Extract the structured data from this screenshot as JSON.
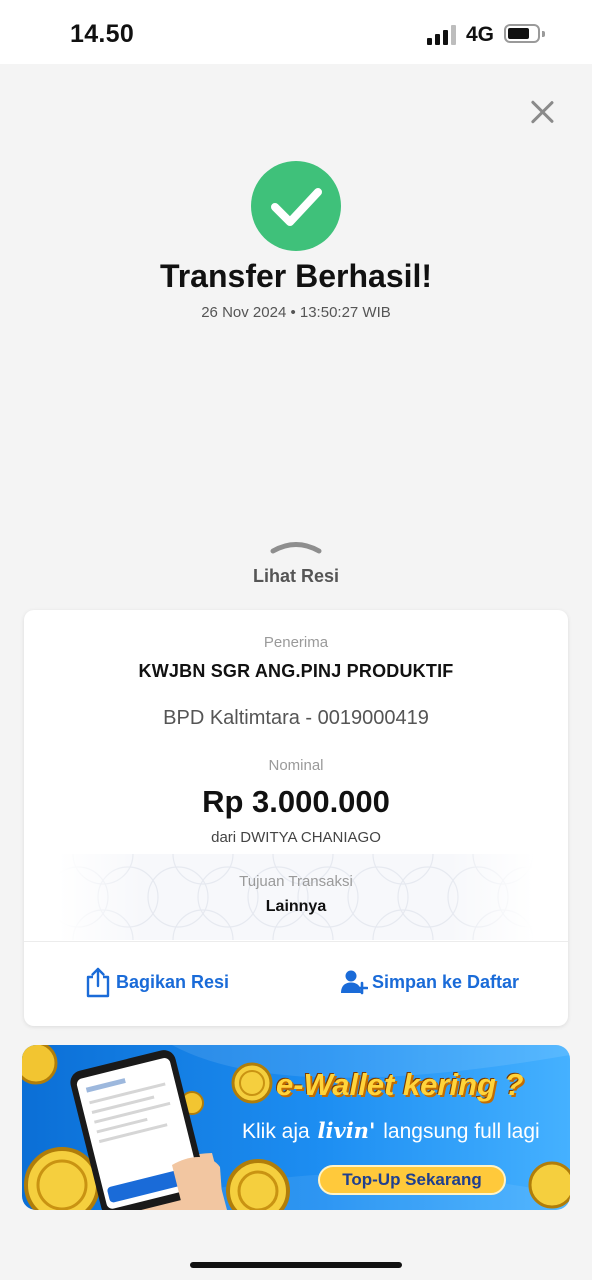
{
  "status_bar": {
    "time": "14.50",
    "network": "4G",
    "signal_bars": 3,
    "signal_bars_total": 4,
    "battery_level": 0.7,
    "icons": [
      "signal-icon",
      "battery-icon"
    ]
  },
  "header": {
    "close_icon": "close-icon",
    "success_icon": "check-circle-icon",
    "success_color": "#3fc17a",
    "title": "Transfer Berhasil!",
    "datetime": "26 Nov 2024 • 13:50:27 WIB"
  },
  "receipt_toggle": {
    "icon": "chevron-up-icon",
    "label": "Lihat Resi"
  },
  "receipt": {
    "recipient_label": "Penerima",
    "recipient_name": "KWJBN SGR ANG.PINJ PRODUKTIF",
    "recipient_bank": "BPD Kaltimtara - 0019000419",
    "amount_label": "Nominal",
    "amount": "Rp 3.000.000",
    "from": "dari DWITYA CHANIAGO",
    "purpose_label": "Tujuan Transaksi",
    "purpose_value": "Lainnya"
  },
  "actions": {
    "share_label": "Bagikan Resi",
    "share_icon": "share-icon",
    "save_label": "Simpan ke Daftar",
    "save_icon": "add-user-icon",
    "accent_color": "#1a6bd8"
  },
  "banner": {
    "headline": "e-Wallet kering ?",
    "sub_prefix": "Klik aja",
    "sub_logo": "livin'",
    "sub_suffix": "langsung full lagi",
    "cta": "Top-Up Sekarang",
    "phone_illustration_icon": "phone-illustration-icon",
    "coin_icon": "coin-icon"
  }
}
